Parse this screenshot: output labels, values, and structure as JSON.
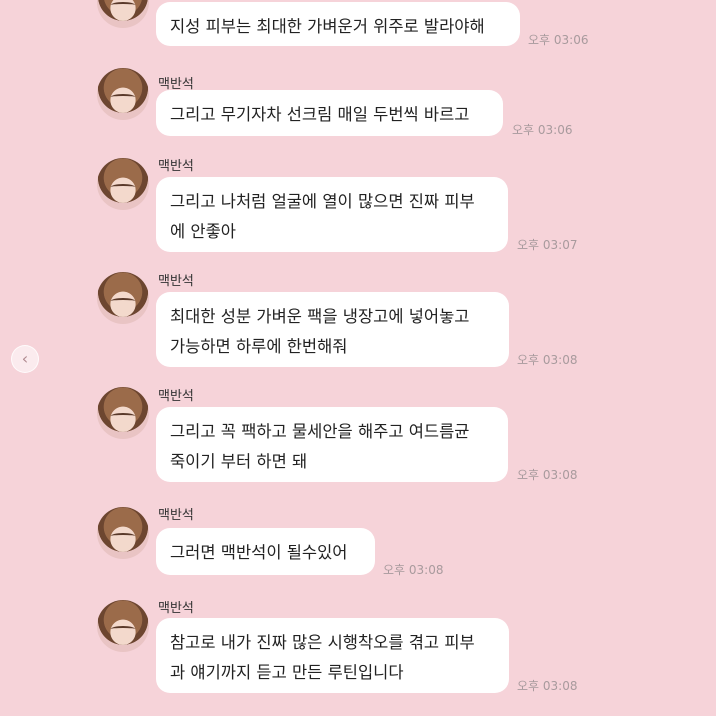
{
  "messages": [
    {
      "sender": "",
      "text": "지성 피부는 최대한 가벼운거 위주로 발라야해",
      "time": "오후 03:06"
    },
    {
      "sender": "맥반석",
      "text": "그리고 무기자차 선크림 매일 두번씩 바르고",
      "time": "오후 03:06"
    },
    {
      "sender": "맥반석",
      "text": "그리고 나처럼 얼굴에 열이 많으면 진짜 피부\n에 안좋아",
      "time": "오후 03:07"
    },
    {
      "sender": "맥반석",
      "text": "최대한 성분 가벼운 팩을 냉장고에 넣어놓고\n가능하면 하루에 한번해줘",
      "time": "오후 03:08"
    },
    {
      "sender": "맥반석",
      "text": "그리고 꼭 팩하고 물세안을 해주고 여드름균\n죽이기 부터 하면 돼",
      "time": "오후 03:08"
    },
    {
      "sender": "맥반석",
      "text": "그러면 맥반석이 될수있어",
      "time": "오후 03:08"
    },
    {
      "sender": "맥반석",
      "text": "참고로 내가 진짜 많은 시행착오를 겪고 피부\n과 얘기까지 듣고 만든 루틴입니다",
      "time": "오후 03:08"
    }
  ],
  "nav": {
    "prev_icon": "‹"
  },
  "colors": {
    "background": "#f6d3d9",
    "bubble": "#ffffff",
    "time": "#a89a9d"
  }
}
